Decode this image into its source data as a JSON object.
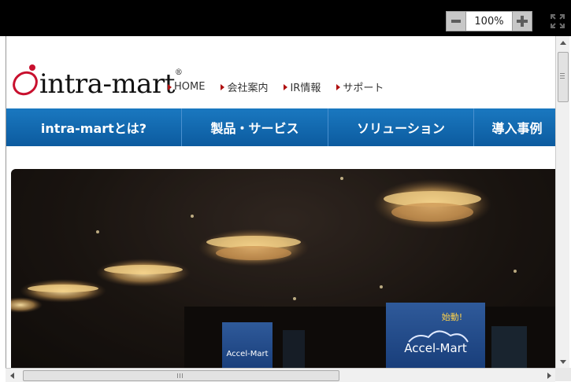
{
  "toolbar": {
    "zoom_value": "100%",
    "zoom_out_icon": "minus-icon",
    "zoom_in_icon": "plus-icon",
    "fullscreen_icon": "expand-icon"
  },
  "site": {
    "logo_text": "intra-mart",
    "logo_mark": "®",
    "top_links": [
      "HOME",
      "会社案内",
      "IR情報",
      "サポート"
    ],
    "main_nav": [
      "intra-martとは?",
      "製品・サービス",
      "ソリューション",
      "導入事例"
    ]
  },
  "hero": {
    "screen_left": "Accel-Mart",
    "screen_right": "Accel-Mart",
    "screen_right_headline": "始動!"
  },
  "colors": {
    "nav_blue": "#0c5b9f",
    "logo_red": "#c8102e"
  }
}
